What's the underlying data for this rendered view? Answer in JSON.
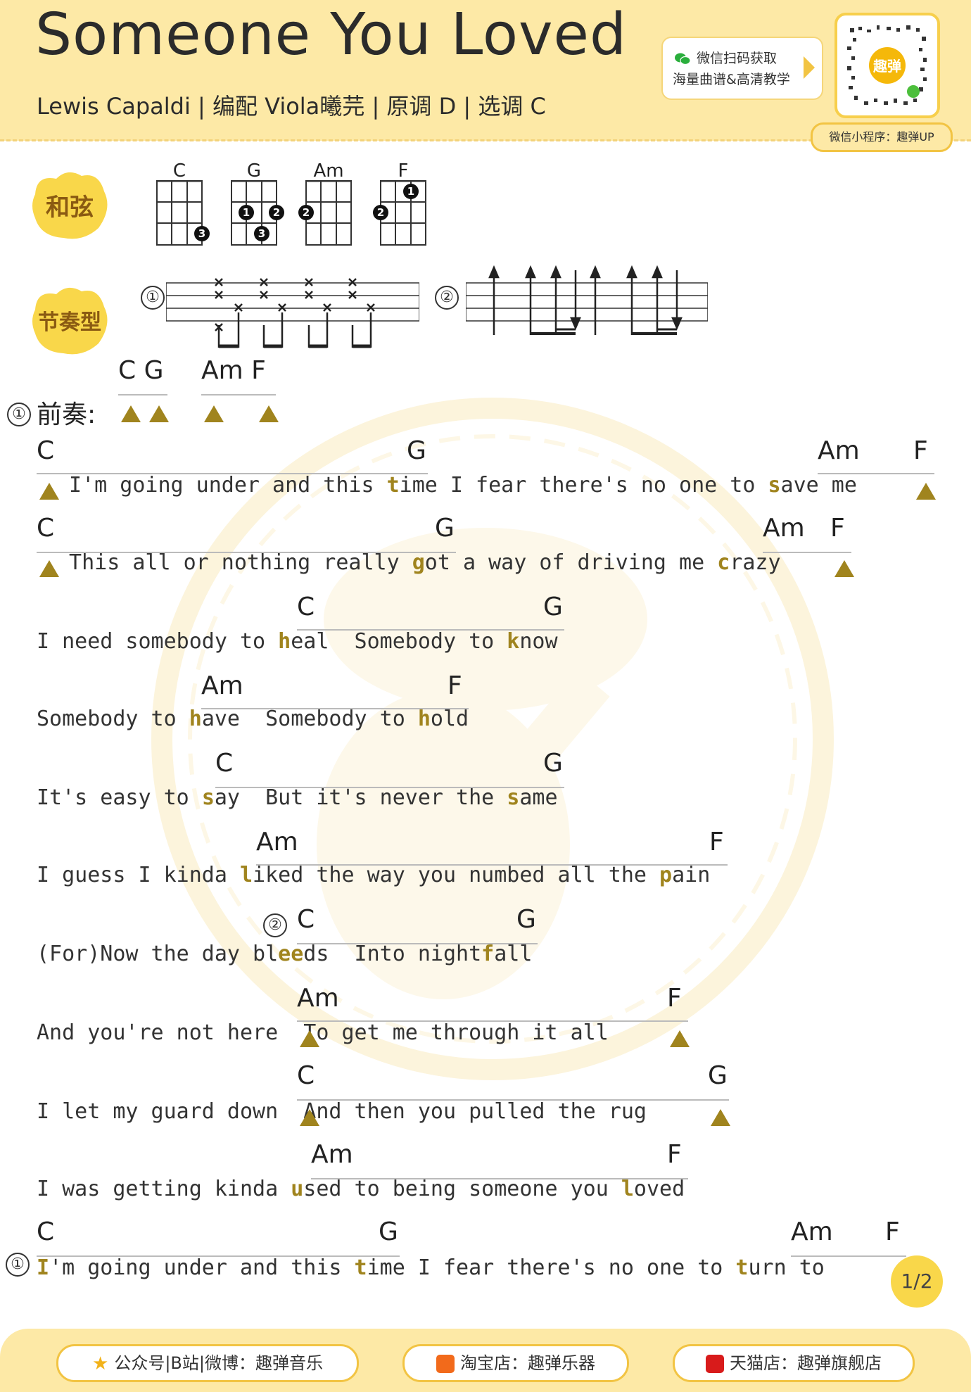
{
  "header": {
    "title": "Someone You Loved",
    "subtitle": "Lewis Capaldi | 编配 Viola曦芫 | 原调 D | 选调 C",
    "promo_line1": "微信扫码获取",
    "promo_line2": "海量曲谱&高清教学",
    "qr_label": "趣弹",
    "qr_tag": "微信小程序：趣弹UP"
  },
  "sections": {
    "chords_badge": "和弦",
    "rhythm_badge": "节奏型",
    "intro_label": "前奏:",
    "intro_marker": "①",
    "verse_marker": "②",
    "chorus_marker": "①"
  },
  "chord_diagrams": [
    {
      "name": "C",
      "fingers": [
        "3"
      ]
    },
    {
      "name": "G",
      "fingers": [
        "1",
        "2",
        "3"
      ]
    },
    {
      "name": "Am",
      "fingers": [
        "2"
      ]
    },
    {
      "name": "F",
      "fingers": [
        "1",
        "2"
      ]
    }
  ],
  "rhythm_patterns": [
    "①",
    "②"
  ],
  "intro_chords": [
    "C G",
    "Am F"
  ],
  "lines": [
    {
      "chords": [
        "C",
        "G",
        "Am",
        "F"
      ],
      "lyric_pre": " I'm going under and this ",
      "lyric_parts": [
        "t",
        "ime I fear there's no one to ",
        "s",
        "ave me"
      ]
    },
    {
      "chords": [
        "C",
        "G",
        "Am",
        "F"
      ],
      "lyric_pre": " This all or nothing really ",
      "lyric_parts": [
        "g",
        "ot a way of driving me ",
        "c",
        "razy"
      ]
    },
    {
      "chords": [
        "C",
        "G"
      ],
      "lyric_pre": "I need somebody to ",
      "lyric_parts": [
        "h",
        "eal  Somebody to ",
        "k",
        "now"
      ]
    },
    {
      "chords": [
        "Am",
        "F"
      ],
      "lyric_pre": "Somebody to ",
      "lyric_parts": [
        "h",
        "ave  Somebody to ",
        "h",
        "old"
      ]
    },
    {
      "chords": [
        "C",
        "G"
      ],
      "lyric_pre": "It's easy to ",
      "lyric_parts": [
        "s",
        "ay  But it's never the ",
        "s",
        "ame"
      ]
    },
    {
      "chords": [
        "Am",
        "F"
      ],
      "lyric_pre": "I guess I kinda ",
      "lyric_parts": [
        "l",
        "iked the way you numbed all the ",
        "p",
        "ain"
      ]
    },
    {
      "chords": [
        "C",
        "G"
      ],
      "lyric_pre": "(For)Now the day bl",
      "lyric_parts": [
        "ee",
        "ds  Into night",
        "f",
        "all"
      ]
    },
    {
      "chords": [
        "Am",
        "F"
      ],
      "lyric_pre": "And you're not here",
      "lyric_parts": [
        "",
        "  To get me through it all",
        "",
        ""
      ]
    },
    {
      "chords": [
        "C",
        "G"
      ],
      "lyric_pre": "I let my guard down",
      "lyric_parts": [
        "",
        "  And then you pulled the rug",
        "",
        ""
      ]
    },
    {
      "chords": [
        "Am",
        "F"
      ],
      "lyric_pre": "I was getting kinda ",
      "lyric_parts": [
        "u",
        "sed to being someone you ",
        "l",
        "oved"
      ]
    },
    {
      "chords": [
        "C",
        "G",
        "Am",
        "F"
      ],
      "lyric_pre": "",
      "lyric_parts": [
        "I",
        "'m going under and this ",
        "t",
        "ime I fear there's no one to "
      ],
      "lyric_tail_bold": "t",
      "lyric_tail": "urn to"
    }
  ],
  "page_number": "1/2",
  "footer": {
    "social": "公众号|B站|微博：趣弹音乐",
    "taobao": "淘宝店：趣弹乐器",
    "tmall": "天猫店：趣弹旗舰店"
  },
  "colors": {
    "accent": "#a0841e",
    "header_bg": "#fde9a6",
    "badge": "#f9d74a"
  }
}
